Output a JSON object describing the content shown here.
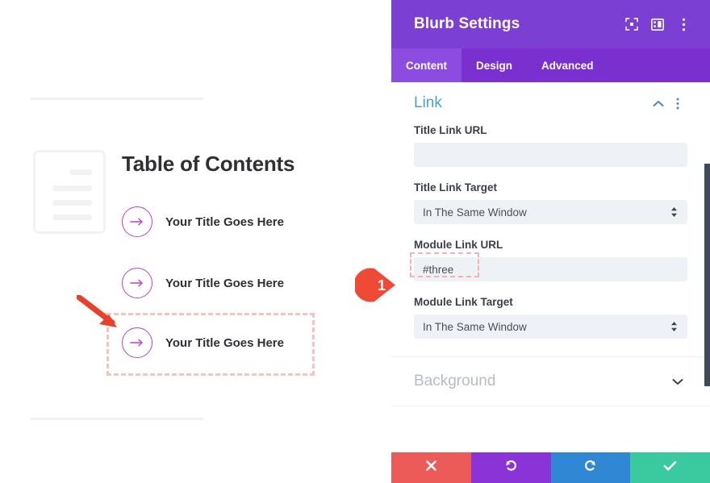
{
  "preview": {
    "heading": "Table of Contents",
    "doc_icon": "document-icon",
    "blurbs": [
      {
        "label": "Your Title Goes Here",
        "icon": "arrow-right-circle-icon"
      },
      {
        "label": "Your Title Goes Here",
        "icon": "arrow-right-circle-icon"
      },
      {
        "label": "Your Title Goes Here",
        "icon": "arrow-right-circle-icon"
      }
    ],
    "selected_index": 2,
    "annotation_arrow": "red-arrow-icon",
    "accent_purple": "#b843c4",
    "selection_outline": "#f3c5c0",
    "annotation_red": "#e8402a"
  },
  "panel": {
    "title": "Blurb Settings",
    "header_icons": [
      {
        "name": "focus-frame-icon"
      },
      {
        "name": "layout-panel-icon"
      },
      {
        "name": "more-vertical-icon"
      }
    ],
    "tabs": [
      {
        "label": "Content",
        "active": true
      },
      {
        "label": "Design",
        "active": false
      },
      {
        "label": "Advanced",
        "active": false
      }
    ],
    "sections": [
      {
        "title": "Link",
        "state": "open",
        "toggle_icon": "chevron-up-icon",
        "menu_icon": "more-vertical-icon"
      },
      {
        "title": "Background",
        "state": "closed",
        "toggle_icon": "chevron-down-icon"
      }
    ],
    "fields": [
      {
        "label": "Title Link URL",
        "type": "text",
        "value": "",
        "placeholder": ""
      },
      {
        "label": "Title Link Target",
        "type": "select",
        "value": "In The Same Window"
      },
      {
        "label": "Module Link URL",
        "type": "text",
        "value": "#three",
        "placeholder": "",
        "highlighted": true
      },
      {
        "label": "Module Link Target",
        "type": "select",
        "value": "In The Same Window"
      }
    ],
    "footer_buttons": [
      {
        "name": "cancel-button",
        "icon": "close-x-icon",
        "color": "#ec5b58"
      },
      {
        "name": "undo-button",
        "icon": "undo-arrow-icon",
        "color": "#8a34d8"
      },
      {
        "name": "redo-button",
        "icon": "redo-arrow-icon",
        "color": "#3088d4"
      },
      {
        "name": "save-button",
        "icon": "check-icon",
        "color": "#3bc9a0"
      }
    ],
    "header_color": "#7b3fd4",
    "tabbar_color": "#7a30cf",
    "active_tab_color": "#8d4ce0",
    "scrollbar_color": "#3f4a5c"
  },
  "callout": {
    "number": "1",
    "color": "#ef4a36"
  }
}
